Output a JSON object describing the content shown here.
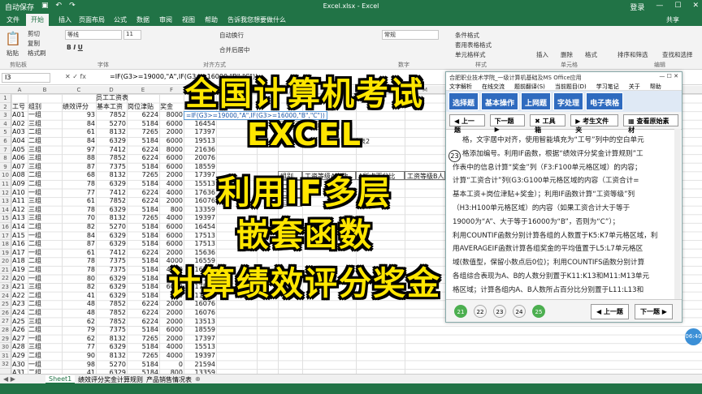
{
  "window": {
    "title": "Excel.xlsx - Excel",
    "login": "登录",
    "share": "共享",
    "save_status": "自动保存"
  },
  "tabs": [
    "文件",
    "开始",
    "插入",
    "页面布局",
    "公式",
    "数据",
    "审阅",
    "视图",
    "帮助",
    "告诉我您想要做什么"
  ],
  "ribbon": {
    "cut": "剪切",
    "copy": "复制",
    "painter": "格式刷",
    "paste": "粘贴",
    "clipboard": "剪贴板",
    "font": "字体",
    "align": "对齐方式",
    "wrap": "自动换行",
    "merge": "合并后居中",
    "number": "数字",
    "general": "常规",
    "cond": "条件格式",
    "table_fmt": "套用表格格式",
    "cell_style": "单元格样式",
    "styles": "样式",
    "insert": "插入",
    "delete": "删除",
    "format": "格式",
    "cells": "单元格",
    "sort": "排序和筛选",
    "find": "查找和选择",
    "edit": "编辑",
    "font_name": "等线",
    "font_size": "11"
  },
  "formula_bar": {
    "name_box": "I3",
    "formula": "=IF(G3>=19000,\"A\",IF(G3>=16000,\"B\",\"C\"))"
  },
  "columns": [
    "A",
    "B",
    "C",
    "D",
    "E",
    "F",
    "G",
    "H",
    "I",
    "J",
    "K",
    "L",
    "M"
  ],
  "sheet": {
    "title": "员工工资表",
    "headers": [
      "工号",
      "组别",
      "绩效评分",
      "基本工资",
      "岗位津贴",
      "奖金",
      "工资合计"
    ],
    "rows": [
      [
        "A01",
        "一组",
        "93",
        "7852",
        "6224",
        "8000",
        "22076"
      ],
      [
        "A02",
        "三组",
        "84",
        "5270",
        "5184",
        "6000",
        "16454"
      ],
      [
        "A03",
        "二组",
        "61",
        "8132",
        "7265",
        "2000",
        "17397"
      ],
      [
        "A04",
        "二组",
        "84",
        "6329",
        "5184",
        "6000",
        "19513"
      ],
      [
        "A05",
        "三组",
        "97",
        "7412",
        "6224",
        "8000",
        "21636"
      ],
      [
        "A06",
        "三组",
        "88",
        "7852",
        "6224",
        "6000",
        "20076"
      ],
      [
        "A07",
        "三组",
        "87",
        "7375",
        "5184",
        "6000",
        "18559"
      ],
      [
        "A08",
        "二组",
        "68",
        "8132",
        "7265",
        "2000",
        "17397"
      ],
      [
        "A09",
        "二组",
        "78",
        "6329",
        "5184",
        "4000",
        "15513"
      ],
      [
        "A10",
        "一组",
        "77",
        "7412",
        "6224",
        "4000",
        "17636"
      ],
      [
        "A11",
        "三组",
        "61",
        "7852",
        "6224",
        "2000",
        "16076"
      ],
      [
        "A12",
        "三组",
        "78",
        "6329",
        "5184",
        "800",
        "13359"
      ],
      [
        "A13",
        "三组",
        "70",
        "8132",
        "7265",
        "4000",
        "19397"
      ],
      [
        "A14",
        "二组",
        "82",
        "5270",
        "5184",
        "6000",
        "16454"
      ],
      [
        "A15",
        "一组",
        "84",
        "6329",
        "5184",
        "6000",
        "17513"
      ],
      [
        "A16",
        "二组",
        "87",
        "6329",
        "5184",
        "6000",
        "17513"
      ],
      [
        "A17",
        "一组",
        "61",
        "7412",
        "6224",
        "2000",
        "15636"
      ],
      [
        "A18",
        "二组",
        "78",
        "7375",
        "5184",
        "4000",
        "16559"
      ],
      [
        "A19",
        "二组",
        "78",
        "7375",
        "5184",
        "4000",
        "16559"
      ],
      [
        "A20",
        "一组",
        "80",
        "6329",
        "5184",
        "6000",
        "17513"
      ],
      [
        "A21",
        "三组",
        "82",
        "6329",
        "5184",
        "6000",
        "17513"
      ],
      [
        "A22",
        "二组",
        "41",
        "6329",
        "5184",
        "0",
        "11513"
      ],
      [
        "A23",
        "二组",
        "48",
        "7852",
        "6224",
        "2000",
        "16076"
      ],
      [
        "A24",
        "二组",
        "48",
        "7852",
        "6224",
        "2000",
        "16076"
      ],
      [
        "A25",
        "三组",
        "62",
        "7852",
        "6224",
        "2000",
        "13513"
      ],
      [
        "A26",
        "二组",
        "79",
        "7375",
        "5184",
        "6000",
        "18559"
      ],
      [
        "A27",
        "一组",
        "62",
        "8132",
        "7265",
        "2000",
        "17397"
      ],
      [
        "A28",
        "三组",
        "77",
        "6329",
        "5184",
        "4000",
        "15513"
      ],
      [
        "A29",
        "二组",
        "90",
        "8132",
        "7265",
        "4000",
        "19397"
      ],
      [
        "A30",
        "一组",
        "98",
        "5270",
        "5184",
        "0",
        "21594"
      ],
      [
        "A31",
        "二组",
        "41",
        "6329",
        "5184",
        "800",
        "13359"
      ]
    ],
    "edit_formula": "=IF(G3>=19000,\"A\",IF(G3>=16000,\"B\",\"C\"))",
    "tooltip": "value_if_false)",
    "stat": {
      "title": "统计表2",
      "headers": [
        "组别",
        "工资等级A人数",
        "A所占百分比",
        "工资等级B人"
      ],
      "groups": [
        "一组",
        "二组",
        "三组"
      ]
    }
  },
  "sheet_tabs": [
    "Sheet1",
    "绩效评分奖金计算规则",
    "产品销售情况表"
  ],
  "panel": {
    "title": "合肥职业技术学院_一级计算机基础及MS Office应用",
    "menu": [
      "文字解析",
      "在线交流",
      "题前翻译(S)",
      "当前题目(D)",
      "学习笔记",
      "关于",
      "帮助"
    ],
    "tabs": [
      "选择题",
      "基本操作",
      "上网题",
      "字处理",
      "电子表格"
    ],
    "nav": [
      "上一题",
      "下一题",
      "工具箱",
      "考生文件夹",
      "查看原始素材"
    ],
    "question_no": "23",
    "text": [
      "格，文字居中对齐，使用智能填充为“工号”列中的空白单元",
      "格添加编号。利用IF函数，根据“绩效评分奖金计算规则”工",
      "作表中的信息计算“奖金”列（F3:F100单元格区域）的内容；",
      "计算“工资合计”列(G3:G100单元格区域的内容（工资合计=",
      "基本工资+岗位津贴+奖金）；利用IF函数计算“工资等级”列",
      "（H3:H100单元格区域）的内容（如果工资合计大于等于",
      "19000为“A”、大于等于16000为“B”，否则为“C”）；",
      "利用COUNTIF函数分别计算各组的人数置于K5:K7单元格区域，利",
      "用AVERAGEIF函数计算各组奖金的平均值置于L5:L7单元格区",
      "域(数值型，保留小数点后0位)；利用COUNTIFS函数分别计算",
      "各组综合表现为A、B的人数分别置于K11:K13和M11:M13单元",
      "格区域；计算各组内A、B人数所占百分比分别置于L11:L13和",
      "N11:N13单元格区域（百分比型，保留小数点后1位）。"
    ],
    "numbers": [
      "21",
      "22",
      "23",
      "24",
      "25"
    ],
    "prev": "上一题",
    "next": "下一题"
  },
  "overlay": {
    "line1": "全国计算机考试",
    "line2": "EXCEL",
    "line3": "利用IF多层",
    "line4": "嵌套函数",
    "line5": "计算绩效评分奖金"
  },
  "clock": "06:40",
  "colors": {
    "excel_green": "#217346",
    "overlay_yellow": "#ffe600",
    "panel_blue": "#2f6bbf"
  }
}
